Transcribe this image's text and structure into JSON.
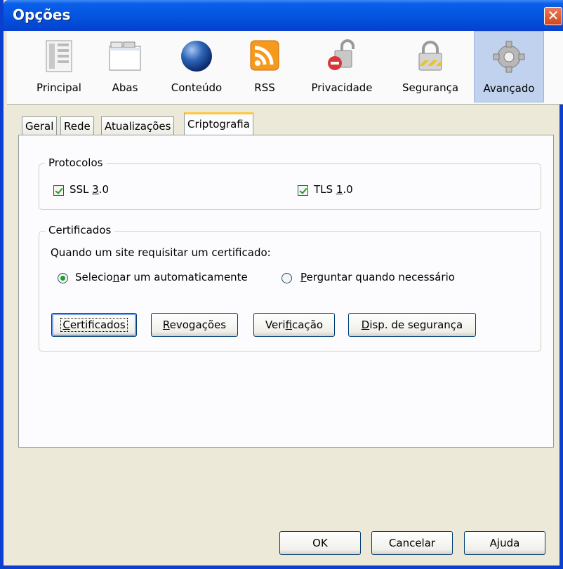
{
  "window": {
    "title": "Opções",
    "close_glyph": "✕"
  },
  "panes": [
    {
      "label": "Principal",
      "icon": "main-icon"
    },
    {
      "label": "Abas",
      "icon": "tabs-icon"
    },
    {
      "label": "Conteúdo",
      "icon": "content-globe-icon"
    },
    {
      "label": "RSS",
      "icon": "rss-icon"
    },
    {
      "label": "Privacidade",
      "icon": "privacy-lock-icon"
    },
    {
      "label": "Segurança",
      "icon": "security-lock-icon"
    },
    {
      "label": "Avançado",
      "icon": "gear-icon",
      "selected": true
    }
  ],
  "tabs": [
    {
      "label": "Geral"
    },
    {
      "label": "Rede"
    },
    {
      "label": "Atualizações"
    },
    {
      "label": "Criptografia",
      "active": true
    }
  ],
  "protocols": {
    "title": "Protocolos",
    "ssl": {
      "label_pre": "SSL ",
      "label_u": "3",
      "label_post": ".0",
      "checked": true
    },
    "tls": {
      "label_pre": "TLS ",
      "label_u": "1",
      "label_post": ".0",
      "checked": true
    }
  },
  "certificates": {
    "title": "Certificados",
    "prompt": "Quando um site requisitar um certificado:",
    "auto": {
      "pre": "Selecio",
      "u": "n",
      "post": "ar um automaticamente",
      "selected": true
    },
    "ask": {
      "pre": "",
      "u": "P",
      "post": "erguntar quando necessário",
      "selected": false
    },
    "buttons": {
      "certs": {
        "pre": "",
        "u": "C",
        "post": "ertificados"
      },
      "revocations": {
        "pre": "",
        "u": "R",
        "post": "evogações"
      },
      "verification": {
        "pre": "Veri",
        "u": "f",
        "post": "icação"
      },
      "devices": {
        "pre": "",
        "u": "D",
        "post": "isp. de segurança"
      }
    }
  },
  "footer": {
    "ok": "OK",
    "cancel": "Cancelar",
    "help": "Ajuda"
  },
  "colors": {
    "titlebar": "#0555e0",
    "active_tab_accent": "#ffc83c",
    "selected_pane": "#c1d2ee",
    "check": "#21a121"
  }
}
